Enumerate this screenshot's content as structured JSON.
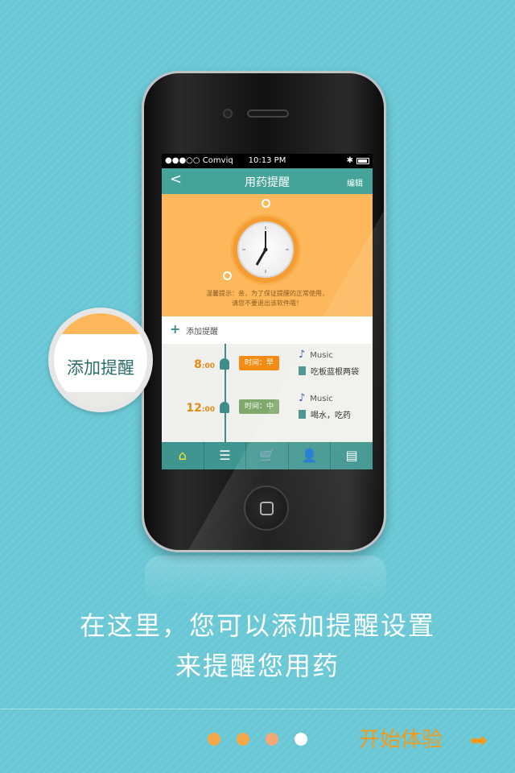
{
  "status_bar": {
    "carrier": "●●●○○ Comviq",
    "time": "10:13 PM",
    "bluetooth": "✱"
  },
  "nav": {
    "back": "<",
    "title": "用药提醒",
    "edit": "编辑"
  },
  "clock": {
    "tip_line1": "温馨提示：亲，为了保证提醒的正常使用，",
    "tip_line2": "请您不要退出该软件哦！"
  },
  "add_reminder": {
    "icon": "+",
    "label": "添加提醒"
  },
  "reminders": [
    {
      "hour": "8",
      "min": ":00",
      "tag": "时间：早",
      "tag_color": "#f28c14",
      "music": "Music",
      "note": "吃板蓝根两袋"
    },
    {
      "hour": "12",
      "min": ":00",
      "tag": "时间：中",
      "tag_color": "#7fa96a",
      "music": "Music",
      "note": "喝水，吃药"
    }
  ],
  "tabbar": [
    {
      "icon": "home-icon",
      "glyph": "⌂"
    },
    {
      "icon": "list-icon",
      "glyph": "☰"
    },
    {
      "icon": "cart-icon",
      "glyph": "🛒"
    },
    {
      "icon": "user-icon",
      "glyph": "👤"
    },
    {
      "icon": "menu-icon",
      "glyph": "▤"
    }
  ],
  "callout": {
    "text": "添加提醒"
  },
  "headline": {
    "line1": "在这里，您可以添加提醒设置",
    "line2": "来提醒您用药"
  },
  "pager": {
    "dots": [
      "#f5a847",
      "#f5a847",
      "#f2a877",
      "#ffffff"
    ]
  },
  "cta": {
    "label": "开始体验",
    "arrow": "➡"
  },
  "colors": {
    "background": "#6ac8d6",
    "accent": "#f39a1b",
    "teal": "#45a39a",
    "panel": "#fdb85c"
  }
}
